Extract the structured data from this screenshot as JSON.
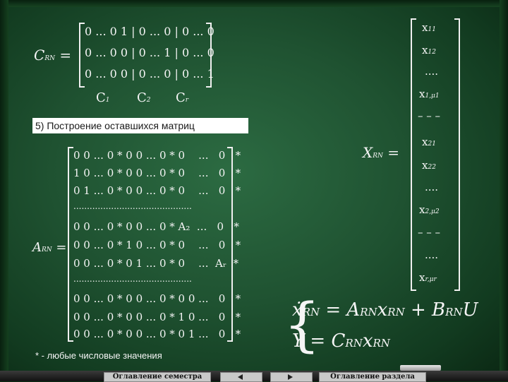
{
  "crn": {
    "name": "C",
    "sub": "RN",
    "rows": [
      "0 ... 0 1 | 0 ... 0 | 0 ... 0",
      "0 ... 0 0 | 0 ... 1 | 0 ... 0",
      "0 ... 0 0 | 0 ... 0 | 0 ... 1"
    ],
    "columns": [
      {
        "name": "C",
        "sub": "1"
      },
      {
        "name": "C",
        "sub": "2"
      },
      {
        "name": "C",
        "sub": "r"
      }
    ]
  },
  "section_title": "5) Построение оставшихся матриц",
  "arn": {
    "name": "A",
    "sub": "RN",
    "rows": [
      "0 0 ... 0 * 0 0 ... 0 * 0    ...   0   *",
      "1 0 ... 0 * 0 0 ... 0 * 0    ...   0   *",
      "0 1 ... 0 * 0 0 ... 0 * 0    ...   0   *",
      "............................................",
      "0 0 ... 0 * 0 0 ... 0 * A₂  ...   0   *",
      "0 0 ... 0 * 1 0 ... 0 * 0    ...   0   *",
      "0 0 ... 0 * 0 1 ... 0 * 0    ...  Aᵣ  *",
      "............................................",
      "0 0 ... 0 * 0 0 ... 0 * 0 0 ...   0   *",
      "0 0 ... 0 * 0 0 ... 0 * 1 0 ...   0   *",
      "0 0 ... 0 * 0 0 ... 0 * 0 1 ...   0   *"
    ]
  },
  "footnote": "* - любые числовые значения",
  "xrn": {
    "name": "X",
    "sub": "RN",
    "entries": [
      {
        "name": "x",
        "sub": "11"
      },
      {
        "name": "x",
        "sub": "12"
      },
      {
        "name": "....",
        "sub": ""
      },
      {
        "name": "x",
        "sub": "1,μ1"
      },
      {
        "name": "– – –",
        "sub": ""
      },
      {
        "name": "x",
        "sub": "21"
      },
      {
        "name": "x",
        "sub": "22"
      },
      {
        "name": "....",
        "sub": ""
      },
      {
        "name": "x",
        "sub": "2,μ2"
      },
      {
        "name": "– – –",
        "sub": ""
      },
      {
        "name": "....",
        "sub": ""
      },
      {
        "name": "x",
        "sub": "r,μr"
      }
    ]
  },
  "system": {
    "eq1": {
      "lhs": "ẋ",
      "lhs_sub": "RN",
      "eq": " = ",
      "a": "A",
      "a_sub": "RN",
      "x": "x",
      "x_sub": "RN",
      "plus": " + ",
      "b": "B",
      "b_sub": "RN",
      "u": "U"
    },
    "eq2": {
      "lhs": "Y",
      "eq": " = ",
      "c": "C",
      "c_sub": "RN",
      "x": "x",
      "x_sub": "RN"
    }
  },
  "nav": {
    "left_label": "Оглавление семестра",
    "right_label": "Оглавление раздела"
  },
  "colors": {
    "board": "#1f5231",
    "chalk": "#f5f5f5",
    "nav_button": "#c9c9c9"
  }
}
